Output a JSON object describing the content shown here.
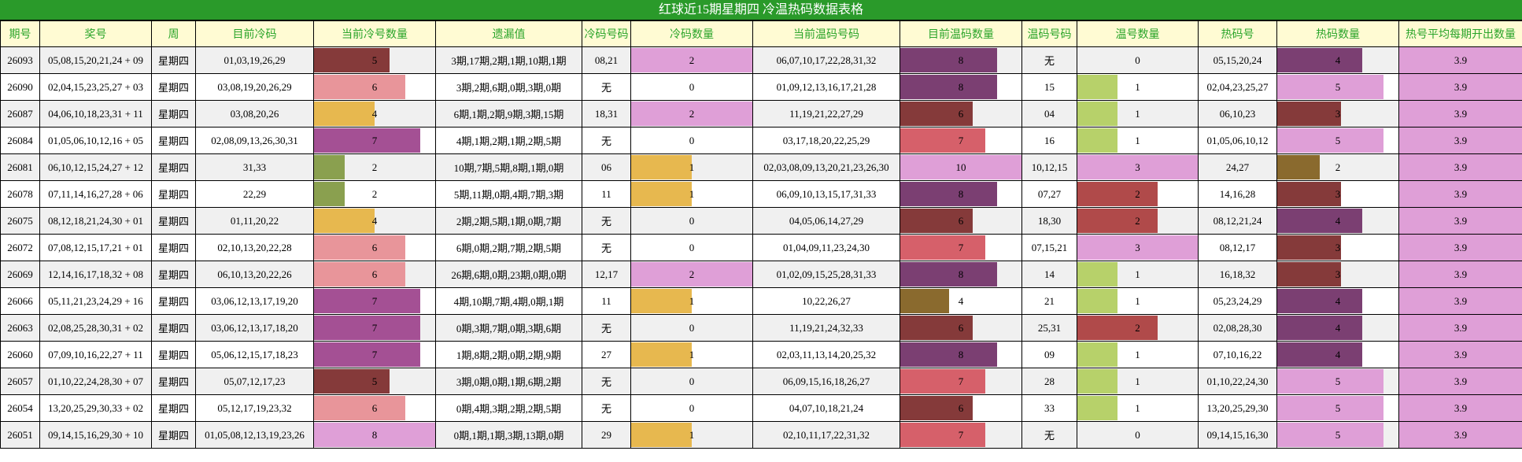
{
  "title": "红球近15期星期四 冷温热码数据表格",
  "headers": [
    "期号",
    "奖号",
    "周",
    "目前冷码",
    "当前冷号数量",
    "遗漏值",
    "冷码号码",
    "冷码数量",
    "当前温码号码",
    "目前温码数量",
    "温码号码",
    "温号数量",
    "热码号",
    "热码数量",
    "热号平均每期开出数量"
  ],
  "rows": [
    {
      "issue": "26093",
      "draw": "05,08,15,20,21,24 + 09",
      "week": "星期四",
      "cold": "01,03,19,26,29",
      "cold_count": 5,
      "miss": "3期,17期,2期,1期,10期,1期",
      "cold_nums": "08,21",
      "cold_num_count": 2,
      "warm": "06,07,10,17,22,28,31,32",
      "warm_count": 8,
      "warm_nums": "无",
      "warm_num_count": 0,
      "hot_nums": "05,15,20,24",
      "hot_count": 4,
      "avg": "3.9"
    },
    {
      "issue": "26090",
      "draw": "02,04,15,23,25,27 + 03",
      "week": "星期四",
      "cold": "03,08,19,20,26,29",
      "cold_count": 6,
      "miss": "3期,2期,6期,0期,3期,0期",
      "cold_nums": "无",
      "cold_num_count": 0,
      "warm": "01,09,12,13,16,17,21,28",
      "warm_count": 8,
      "warm_nums": "15",
      "warm_num_count": 1,
      "hot_nums": "02,04,23,25,27",
      "hot_count": 5,
      "avg": "3.9"
    },
    {
      "issue": "26087",
      "draw": "04,06,10,18,23,31 + 11",
      "week": "星期四",
      "cold": "03,08,20,26",
      "cold_count": 4,
      "miss": "6期,1期,2期,9期,3期,15期",
      "cold_nums": "18,31",
      "cold_num_count": 2,
      "warm": "11,19,21,22,27,29",
      "warm_count": 6,
      "warm_nums": "04",
      "warm_num_count": 1,
      "hot_nums": "06,10,23",
      "hot_count": 3,
      "avg": "3.9"
    },
    {
      "issue": "26084",
      "draw": "01,05,06,10,12,16 + 05",
      "week": "星期四",
      "cold": "02,08,09,13,26,30,31",
      "cold_count": 7,
      "miss": "4期,1期,2期,1期,2期,5期",
      "cold_nums": "无",
      "cold_num_count": 0,
      "warm": "03,17,18,20,22,25,29",
      "warm_count": 7,
      "warm_nums": "16",
      "warm_num_count": 1,
      "hot_nums": "01,05,06,10,12",
      "hot_count": 5,
      "avg": "3.9"
    },
    {
      "issue": "26081",
      "draw": "06,10,12,15,24,27 + 12",
      "week": "星期四",
      "cold": "31,33",
      "cold_count": 2,
      "miss": "10期,7期,5期,8期,1期,0期",
      "cold_nums": "06",
      "cold_num_count": 1,
      "warm": "02,03,08,09,13,20,21,23,26,30",
      "warm_count": 10,
      "warm_nums": "10,12,15",
      "warm_num_count": 3,
      "hot_nums": "24,27",
      "hot_count": 2,
      "avg": "3.9"
    },
    {
      "issue": "26078",
      "draw": "07,11,14,16,27,28 + 06",
      "week": "星期四",
      "cold": "22,29",
      "cold_count": 2,
      "miss": "5期,11期,0期,4期,7期,3期",
      "cold_nums": "11",
      "cold_num_count": 1,
      "warm": "06,09,10,13,15,17,31,33",
      "warm_count": 8,
      "warm_nums": "07,27",
      "warm_num_count": 2,
      "hot_nums": "14,16,28",
      "hot_count": 3,
      "avg": "3.9"
    },
    {
      "issue": "26075",
      "draw": "08,12,18,21,24,30 + 01",
      "week": "星期四",
      "cold": "01,11,20,22",
      "cold_count": 4,
      "miss": "2期,2期,5期,1期,0期,7期",
      "cold_nums": "无",
      "cold_num_count": 0,
      "warm": "04,05,06,14,27,29",
      "warm_count": 6,
      "warm_nums": "18,30",
      "warm_num_count": 2,
      "hot_nums": "08,12,21,24",
      "hot_count": 4,
      "avg": "3.9"
    },
    {
      "issue": "26072",
      "draw": "07,08,12,15,17,21 + 01",
      "week": "星期四",
      "cold": "02,10,13,20,22,28",
      "cold_count": 6,
      "miss": "6期,0期,2期,7期,2期,5期",
      "cold_nums": "无",
      "cold_num_count": 0,
      "warm": "01,04,09,11,23,24,30",
      "warm_count": 7,
      "warm_nums": "07,15,21",
      "warm_num_count": 3,
      "hot_nums": "08,12,17",
      "hot_count": 3,
      "avg": "3.9"
    },
    {
      "issue": "26069",
      "draw": "12,14,16,17,18,32 + 08",
      "week": "星期四",
      "cold": "06,10,13,20,22,26",
      "cold_count": 6,
      "miss": "26期,6期,0期,23期,0期,0期",
      "cold_nums": "12,17",
      "cold_num_count": 2,
      "warm": "01,02,09,15,25,28,31,33",
      "warm_count": 8,
      "warm_nums": "14",
      "warm_num_count": 1,
      "hot_nums": "16,18,32",
      "hot_count": 3,
      "avg": "3.9"
    },
    {
      "issue": "26066",
      "draw": "05,11,21,23,24,29 + 16",
      "week": "星期四",
      "cold": "03,06,12,13,17,19,20",
      "cold_count": 7,
      "miss": "4期,10期,7期,4期,0期,1期",
      "cold_nums": "11",
      "cold_num_count": 1,
      "warm": "10,22,26,27",
      "warm_count": 4,
      "warm_nums": "21",
      "warm_num_count": 1,
      "hot_nums": "05,23,24,29",
      "hot_count": 4,
      "avg": "3.9"
    },
    {
      "issue": "26063",
      "draw": "02,08,25,28,30,31 + 02",
      "week": "星期四",
      "cold": "03,06,12,13,17,18,20",
      "cold_count": 7,
      "miss": "0期,3期,7期,0期,3期,6期",
      "cold_nums": "无",
      "cold_num_count": 0,
      "warm": "11,19,21,24,32,33",
      "warm_count": 6,
      "warm_nums": "25,31",
      "warm_num_count": 2,
      "hot_nums": "02,08,28,30",
      "hot_count": 4,
      "avg": "3.9"
    },
    {
      "issue": "26060",
      "draw": "07,09,10,16,22,27 + 11",
      "week": "星期四",
      "cold": "05,06,12,15,17,18,23",
      "cold_count": 7,
      "miss": "1期,8期,2期,0期,2期,9期",
      "cold_nums": "27",
      "cold_num_count": 1,
      "warm": "02,03,11,13,14,20,25,32",
      "warm_count": 8,
      "warm_nums": "09",
      "warm_num_count": 1,
      "hot_nums": "07,10,16,22",
      "hot_count": 4,
      "avg": "3.9"
    },
    {
      "issue": "26057",
      "draw": "01,10,22,24,28,30 + 07",
      "week": "星期四",
      "cold": "05,07,12,17,23",
      "cold_count": 5,
      "miss": "3期,0期,0期,1期,6期,2期",
      "cold_nums": "无",
      "cold_num_count": 0,
      "warm": "06,09,15,16,18,26,27",
      "warm_count": 7,
      "warm_nums": "28",
      "warm_num_count": 1,
      "hot_nums": "01,10,22,24,30",
      "hot_count": 5,
      "avg": "3.9"
    },
    {
      "issue": "26054",
      "draw": "13,20,25,29,30,33 + 02",
      "week": "星期四",
      "cold": "05,12,17,19,23,32",
      "cold_count": 6,
      "miss": "0期,4期,3期,2期,2期,5期",
      "cold_nums": "无",
      "cold_num_count": 0,
      "warm": "04,07,10,18,21,24",
      "warm_count": 6,
      "warm_nums": "33",
      "warm_num_count": 1,
      "hot_nums": "13,20,25,29,30",
      "hot_count": 5,
      "avg": "3.9"
    },
    {
      "issue": "26051",
      "draw": "09,14,15,16,29,30 + 10",
      "week": "星期四",
      "cold": "01,05,08,12,13,19,23,26",
      "cold_count": 8,
      "miss": "0期,1期,1期,3期,13期,0期",
      "cold_nums": "29",
      "cold_num_count": 1,
      "warm": "02,10,11,17,22,31,32",
      "warm_count": 7,
      "warm_nums": "无",
      "warm_num_count": 0,
      "hot_nums": "09,14,15,16,30",
      "hot_count": 5,
      "avg": "3.9"
    }
  ],
  "colors": {
    "title_bg": "#2a9a2a",
    "header_bg": "#fffbd3",
    "header_text": "#2aa52a",
    "bars": {
      "1": "#e7b84f",
      "2": "#8aa04f",
      "3": "#853a3a",
      "4": "#e7b84f",
      "5": "#853a3a",
      "6": "#e8959a",
      "7": "#a45094",
      "8": "#df9fd7",
      "10": "#df9fd7"
    },
    "cold_num_count": {
      "1": "#e7b84f",
      "2": "#df9fd7"
    },
    "warm_count": {
      "4": "#8a6a2e",
      "6": "#853a3a",
      "7": "#d6606a",
      "8": "#7b3f72",
      "10": "#df9fd7"
    },
    "warm_num_count": {
      "1": "#b7d16a",
      "2": "#b04a4a",
      "3": "#df9fd7"
    },
    "hot_count": {
      "2": "#8a6a2e",
      "3": "#853a3a",
      "4": "#7b3f72",
      "5": "#df9fd7"
    },
    "avg_bg": "#df9fd7"
  }
}
